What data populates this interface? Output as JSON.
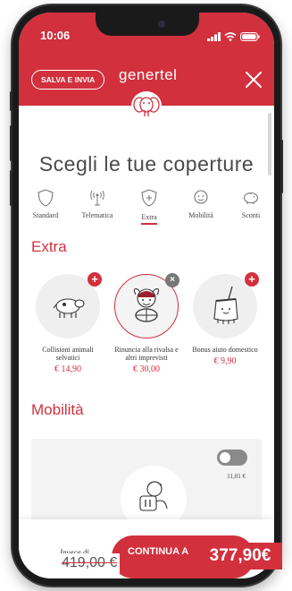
{
  "status_bar": {
    "time": "10:06"
  },
  "header": {
    "save_label": "SALVA E INVIA",
    "logo_text": "genertel"
  },
  "main": {
    "title": "Scegli le tue coperture",
    "tabs": [
      {
        "label": "Standard",
        "icon": "shield-icon"
      },
      {
        "label": "Telematica",
        "icon": "antenna-icon"
      },
      {
        "label": "Extra",
        "icon": "shield-plus-icon",
        "active": true
      },
      {
        "label": "Mobilità",
        "icon": "person-icon"
      },
      {
        "label": "Sconti",
        "icon": "piggy-bank-icon"
      }
    ]
  },
  "extra": {
    "section_title": "Extra",
    "cards": [
      {
        "name": "Collisioni animali selvatici",
        "price": "€ 14,90",
        "icon": "cow-icon",
        "badge": "+"
      },
      {
        "name": "Rinuncia alla rivalsa e altri imprevisti",
        "price": "€ 30,00",
        "icon": "driver-icon",
        "badge": "×"
      },
      {
        "name": "Bonus aiuto domestico",
        "price": "€ 9,90",
        "icon": "broom-icon",
        "badge": "+"
      }
    ]
  },
  "mobility": {
    "section_title": "Mobilità",
    "price": "11,01 €",
    "icon": "person-card-icon"
  },
  "footer": {
    "instead_label": "Invece di",
    "continue_label": "CONTINUA A",
    "old_price": "419,00 €",
    "new_price": "377,90€"
  },
  "colors": {
    "brand_red": "#d2303d"
  }
}
